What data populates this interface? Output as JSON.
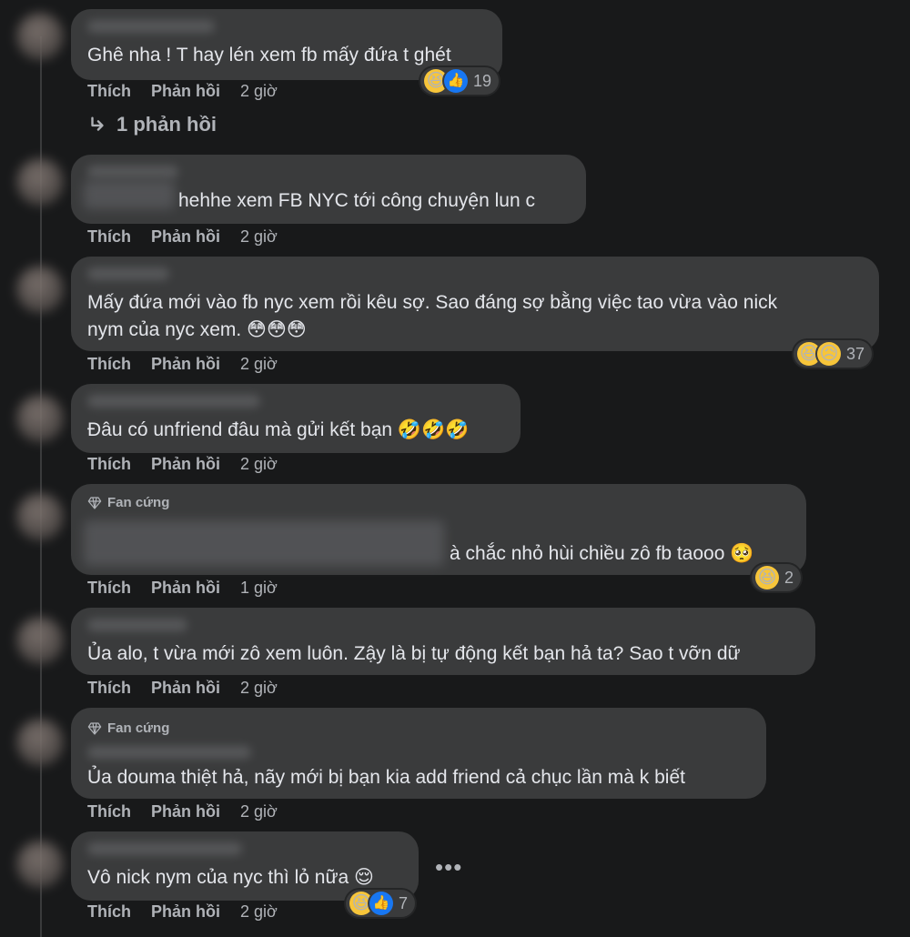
{
  "labels": {
    "like": "Thích",
    "reply": "Phản hồi"
  },
  "reply_link": {
    "icon": "reply-arrow-icon",
    "label": "1 phản hồi"
  },
  "badge_label": "Fan cứng",
  "comments": [
    {
      "text_lines": [
        "Ghê nha ! T hay lén xem fb mấy đứa t ghét"
      ],
      "time": "2 giờ",
      "reactions": {
        "emojis": [
          "😆",
          "👍"
        ],
        "count": "19"
      }
    },
    {
      "text_lines": [
        "hehhe xem FB NYC tới công chuyện lun c"
      ],
      "time": "2 giờ"
    },
    {
      "text_lines": [
        "Mấy đứa mới vào fb nyc xem rồi kêu sợ. Sao đáng sợ bằng việc tao vừa vào nick",
        "nym của nyc xem. 😳😳😳"
      ],
      "time": "2 giờ",
      "reactions": {
        "emojis": [
          "😆",
          "😥"
        ],
        "count": "37"
      }
    },
    {
      "text_lines": [
        "Đâu có unfriend đâu mà gửi kết bạn 🤣🤣🤣"
      ],
      "time": "2 giờ"
    },
    {
      "text_lines": [
        "à chắc nhỏ hùi chiều zô fb taooo 🥺"
      ],
      "time": "1 giờ",
      "badge": true,
      "reactions": {
        "emojis": [
          "😆"
        ],
        "count": "2"
      }
    },
    {
      "text_lines": [
        "Ủa alo, t vừa mới zô xem luôn. Zậy là bị tự động kết bạn hả ta? Sao t vỡn dữ"
      ],
      "time": "2 giờ"
    },
    {
      "text_lines": [
        "Ủa douma thiệt hả, nãy mới bị bạn kia add friend cả chục lần mà k biết"
      ],
      "time": "2 giờ",
      "badge": true
    },
    {
      "text_lines": [
        "Vô nick nym của nyc thì lỏ nữa 😌"
      ],
      "time": "2 giờ",
      "reactions": {
        "emojis": [
          "😆",
          "👍"
        ],
        "count": "7"
      }
    }
  ],
  "more_label": "•••"
}
